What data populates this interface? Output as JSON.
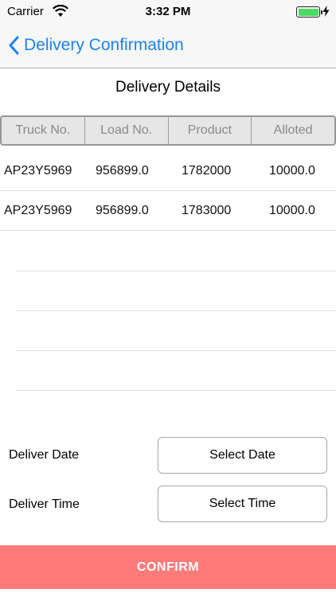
{
  "status_bar": {
    "carrier": "Carrier",
    "time": "3:32 PM",
    "battery_color": "#4cd964"
  },
  "nav": {
    "title": "Delivery Confirmation",
    "back_icon": "chevron-left-icon",
    "accent": "#1a84f5"
  },
  "section_title": "Delivery Details",
  "table": {
    "columns": [
      "Truck No.",
      "Load No.",
      "Product",
      "Alloted"
    ],
    "rows": [
      [
        "AP23Y5969",
        "956899.0",
        "1782000",
        "10000.0"
      ],
      [
        "AP23Y5969",
        "956899.0",
        "1783000",
        "10000.0"
      ]
    ]
  },
  "form": {
    "date_label": "Deliver Date",
    "date_button": "Select Date",
    "time_label": "Deliver Time",
    "time_button": "Select Time"
  },
  "confirm": {
    "label": "CONFIRM",
    "color": "#ff7b7b"
  }
}
